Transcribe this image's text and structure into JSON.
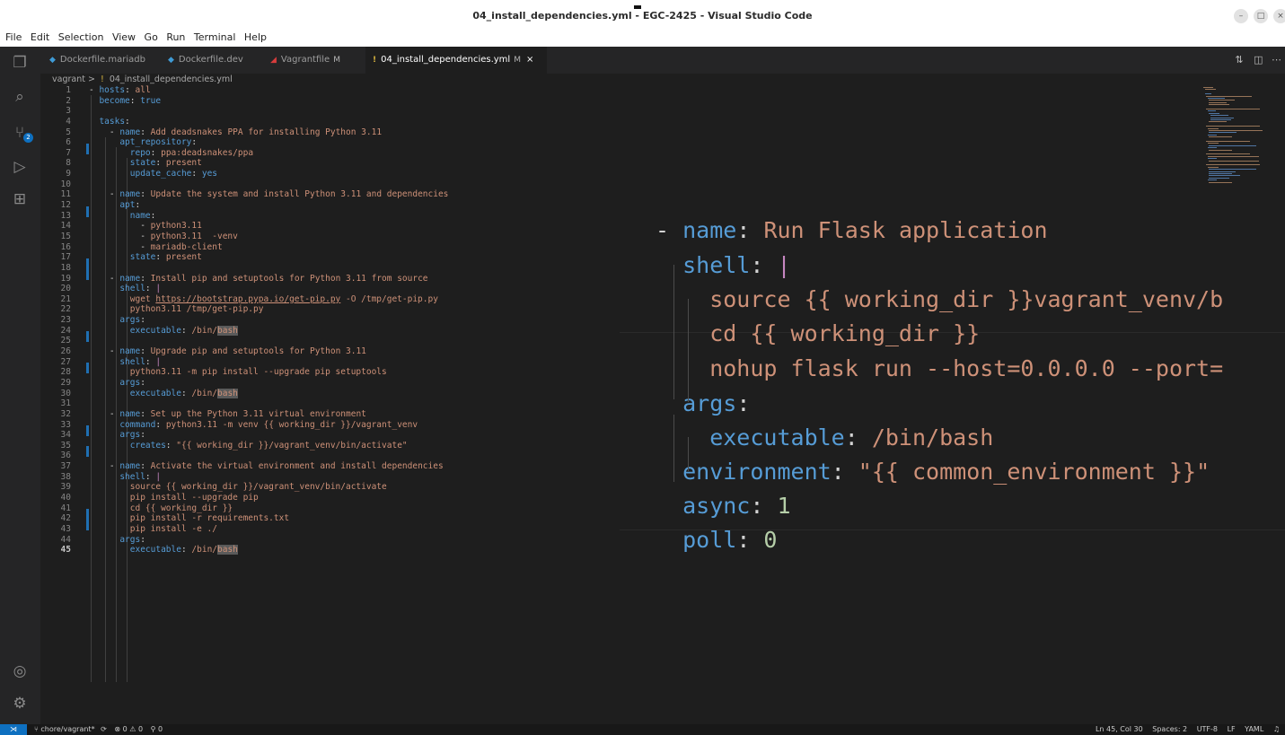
{
  "window": {
    "title": "04_install_dependencies.yml - EGC-2425 - Visual Studio Code",
    "controls": [
      "minimize-icon",
      "maximize-icon",
      "close-icon"
    ]
  },
  "menu": [
    "File",
    "Edit",
    "Selection",
    "View",
    "Go",
    "Run",
    "Terminal",
    "Help"
  ],
  "activity_bar": {
    "icons": [
      "explorer-icon",
      "search-icon",
      "source-control-icon",
      "run-debug-icon",
      "extensions-icon",
      "account-icon",
      "settings-gear-icon"
    ],
    "scm_badge": "2"
  },
  "tabs": [
    {
      "label": "Dockerfile.mariadb",
      "modified": "",
      "icon": "docker-icon",
      "active": false
    },
    {
      "label": "Dockerfile.dev",
      "modified": "",
      "icon": "docker-icon",
      "active": false
    },
    {
      "label": "Vagrantfile",
      "modified": "M",
      "icon": "ruby-icon",
      "active": false
    },
    {
      "label": "04_install_dependencies.yml",
      "modified": "M",
      "icon": "yaml-icon",
      "active": true
    }
  ],
  "breadcrumb": {
    "folder": "vagrant",
    "separator": ">",
    "yaml_mark": "!",
    "file": "04_install_dependencies.yml"
  },
  "editor": {
    "current_line": 45,
    "line_numbers": [
      "1",
      "2",
      "3",
      "4",
      "5",
      "6",
      "7",
      "8",
      "9",
      "10",
      "11",
      "12",
      "13",
      "14",
      "15",
      "16",
      "17",
      "18",
      "19",
      "20",
      "21",
      "22",
      "23",
      "24",
      "25",
      "26",
      "27",
      "28",
      "29",
      "30",
      "31",
      "32",
      "33",
      "34",
      "35",
      "36",
      "37",
      "38",
      "39",
      "40",
      "41",
      "42",
      "43",
      "44",
      "45"
    ],
    "lines": [
      [
        {
          "t": "- ",
          "c": "p"
        },
        {
          "t": "hosts",
          "c": "k"
        },
        {
          "t": ": ",
          "c": "p"
        },
        {
          "t": "all",
          "c": "s"
        }
      ],
      [
        {
          "t": "  become",
          "c": "k"
        },
        {
          "t": ": ",
          "c": "p"
        },
        {
          "t": "true",
          "c": "b"
        }
      ],
      [],
      [
        {
          "t": "  tasks",
          "c": "k"
        },
        {
          "t": ":",
          "c": "p"
        }
      ],
      [
        {
          "t": "    - ",
          "c": "p"
        },
        {
          "t": "name",
          "c": "k"
        },
        {
          "t": ": ",
          "c": "p"
        },
        {
          "t": "Add deadsnakes PPA for installing Python 3.11",
          "c": "s"
        }
      ],
      [
        {
          "t": "      apt_repository",
          "c": "k"
        },
        {
          "t": ":",
          "c": "p"
        }
      ],
      [
        {
          "t": "        repo",
          "c": "k"
        },
        {
          "t": ": ",
          "c": "p"
        },
        {
          "t": "ppa:deadsnakes/ppa",
          "c": "s"
        }
      ],
      [
        {
          "t": "        state",
          "c": "k"
        },
        {
          "t": ": ",
          "c": "p"
        },
        {
          "t": "present",
          "c": "s"
        }
      ],
      [
        {
          "t": "        update_cache",
          "c": "k"
        },
        {
          "t": ": ",
          "c": "p"
        },
        {
          "t": "yes",
          "c": "b"
        }
      ],
      [],
      [
        {
          "t": "    - ",
          "c": "p"
        },
        {
          "t": "name",
          "c": "k"
        },
        {
          "t": ": ",
          "c": "p"
        },
        {
          "t": "Update the system and install Python 3.11 and dependencies",
          "c": "s"
        }
      ],
      [
        {
          "t": "      apt",
          "c": "k"
        },
        {
          "t": ":",
          "c": "p"
        }
      ],
      [
        {
          "t": "        name",
          "c": "k"
        },
        {
          "t": ":",
          "c": "p"
        }
      ],
      [
        {
          "t": "          - ",
          "c": "p"
        },
        {
          "t": "python3.11",
          "c": "s"
        }
      ],
      [
        {
          "t": "          - ",
          "c": "p"
        },
        {
          "t": "python3.11  -venv",
          "c": "s"
        }
      ],
      [
        {
          "t": "          - ",
          "c": "p"
        },
        {
          "t": "mariadb-client",
          "c": "s"
        }
      ],
      [
        {
          "t": "        state",
          "c": "k"
        },
        {
          "t": ": ",
          "c": "p"
        },
        {
          "t": "present",
          "c": "s"
        }
      ],
      [],
      [
        {
          "t": "    - ",
          "c": "p"
        },
        {
          "t": "name",
          "c": "k"
        },
        {
          "t": ": ",
          "c": "p"
        },
        {
          "t": "Install pip and setuptools for Python 3.11 from source",
          "c": "s"
        }
      ],
      [
        {
          "t": "      shell",
          "c": "k"
        },
        {
          "t": ": ",
          "c": "p"
        },
        {
          "t": "|",
          "c": "pipe"
        }
      ],
      [
        {
          "t": "        wget ",
          "c": "s"
        },
        {
          "t": "https://bootstrap.pypa.io/get-pip.py",
          "c": "link"
        },
        {
          "t": " -O /tmp/get-pip.py",
          "c": "s"
        }
      ],
      [
        {
          "t": "        python3.11 /tmp/get-pip.py",
          "c": "s"
        }
      ],
      [
        {
          "t": "      args",
          "c": "k"
        },
        {
          "t": ":",
          "c": "p"
        }
      ],
      [
        {
          "t": "        executable",
          "c": "k"
        },
        {
          "t": ": ",
          "c": "p"
        },
        {
          "t": "/bin/",
          "c": "s"
        },
        {
          "t": "bash",
          "c": "hl"
        }
      ],
      [],
      [
        {
          "t": "    - ",
          "c": "p"
        },
        {
          "t": "name",
          "c": "k"
        },
        {
          "t": ": ",
          "c": "p"
        },
        {
          "t": "Upgrade pip and setuptools for Python 3.11",
          "c": "s"
        }
      ],
      [
        {
          "t": "      shell",
          "c": "k"
        },
        {
          "t": ": ",
          "c": "p"
        },
        {
          "t": "|",
          "c": "pipe"
        }
      ],
      [
        {
          "t": "        python3.11 -m pip install --upgrade pip setuptools",
          "c": "s"
        }
      ],
      [
        {
          "t": "      args",
          "c": "k"
        },
        {
          "t": ":",
          "c": "p"
        }
      ],
      [
        {
          "t": "        executable",
          "c": "k"
        },
        {
          "t": ": ",
          "c": "p"
        },
        {
          "t": "/bin/",
          "c": "s"
        },
        {
          "t": "bash",
          "c": "hl"
        }
      ],
      [],
      [
        {
          "t": "    - ",
          "c": "p"
        },
        {
          "t": "name",
          "c": "k"
        },
        {
          "t": ": ",
          "c": "p"
        },
        {
          "t": "Set up the Python 3.11 virtual environment",
          "c": "s"
        }
      ],
      [
        {
          "t": "      command",
          "c": "k"
        },
        {
          "t": ": ",
          "c": "p"
        },
        {
          "t": "python3.11 -m venv {{ working_dir }}/vagrant_venv",
          "c": "s"
        }
      ],
      [
        {
          "t": "      args",
          "c": "k"
        },
        {
          "t": ":",
          "c": "p"
        }
      ],
      [
        {
          "t": "        creates",
          "c": "k"
        },
        {
          "t": ": ",
          "c": "p"
        },
        {
          "t": "\"{{ working_dir }}/vagrant_venv/bin/activate\"",
          "c": "s"
        }
      ],
      [],
      [
        {
          "t": "    - ",
          "c": "p"
        },
        {
          "t": "name",
          "c": "k"
        },
        {
          "t": ": ",
          "c": "p"
        },
        {
          "t": "Activate the virtual environment and install dependencies",
          "c": "s"
        }
      ],
      [
        {
          "t": "      shell",
          "c": "k"
        },
        {
          "t": ": ",
          "c": "p"
        },
        {
          "t": "|",
          "c": "pipe"
        }
      ],
      [
        {
          "t": "        source {{ working_dir }}/vagrant_venv/bin/activate",
          "c": "s"
        }
      ],
      [
        {
          "t": "        pip install --upgrade pip",
          "c": "s"
        }
      ],
      [
        {
          "t": "        cd {{ working_dir }}",
          "c": "s"
        }
      ],
      [
        {
          "t": "        pip install -r requirements.txt",
          "c": "s"
        }
      ],
      [
        {
          "t": "        pip install -e ./",
          "c": "s"
        }
      ],
      [
        {
          "t": "      args",
          "c": "k"
        },
        {
          "t": ":",
          "c": "p"
        }
      ],
      [
        {
          "t": "        executable",
          "c": "k"
        },
        {
          "t": ": ",
          "c": "p"
        },
        {
          "t": "/bin/",
          "c": "s"
        },
        {
          "t": "bash",
          "c": "hl"
        }
      ]
    ]
  },
  "zoomed_snippet": [
    [
      {
        "t": "- ",
        "c": "p"
      },
      {
        "t": "name",
        "c": "k"
      },
      {
        "t": ": ",
        "c": "p"
      },
      {
        "t": "Run Flask application",
        "c": "s"
      }
    ],
    [
      {
        "t": "  shell",
        "c": "k"
      },
      {
        "t": ": ",
        "c": "p"
      },
      {
        "t": "|",
        "c": "pipe"
      }
    ],
    [
      {
        "t": "    source {{ working_dir }}vagrant_venv/b",
        "c": "s"
      }
    ],
    [
      {
        "t": "    cd {{ working_dir }}",
        "c": "s"
      }
    ],
    [
      {
        "t": "    nohup flask run --host=0.0.0.0 --port=",
        "c": "s"
      }
    ],
    [
      {
        "t": "  args",
        "c": "k"
      },
      {
        "t": ":",
        "c": "p"
      }
    ],
    [
      {
        "t": "    executable",
        "c": "k"
      },
      {
        "t": ": ",
        "c": "p"
      },
      {
        "t": "/bin/bash",
        "c": "s"
      }
    ],
    [
      {
        "t": "  environment",
        "c": "k"
      },
      {
        "t": ": ",
        "c": "p"
      },
      {
        "t": "\"{{ common_environment }}\"",
        "c": "s"
      }
    ],
    [
      {
        "t": "  async",
        "c": "k"
      },
      {
        "t": ": ",
        "c": "p"
      },
      {
        "t": "1",
        "c": "num"
      }
    ],
    [
      {
        "t": "  poll",
        "c": "k"
      },
      {
        "t": ": ",
        "c": "p"
      },
      {
        "t": "0",
        "c": "num"
      }
    ]
  ],
  "status_bar": {
    "branch": "chore/vagrant*",
    "problems": "⊗ 0 ⚠ 0",
    "ports": "⚲ 0",
    "position": "Ln 45, Col 30",
    "spaces": "Spaces: 2",
    "encoding": "UTF-8",
    "eol": "LF",
    "language": "YAML"
  },
  "colors": {
    "key": "#569cd6",
    "string": "#ce9178",
    "number": "#b5cea8",
    "editor_bg": "#1e1e1e",
    "accent": "#0e70c0"
  }
}
